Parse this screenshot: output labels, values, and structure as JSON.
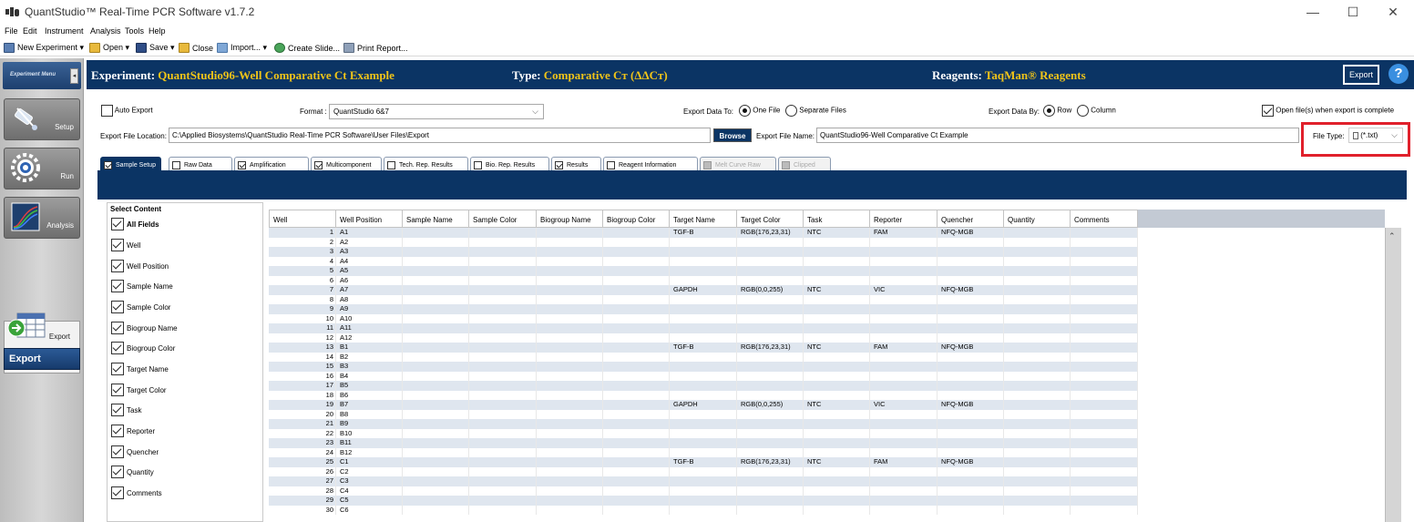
{
  "window": {
    "title": "QuantStudio™ Real-Time PCR Software v1.7.2",
    "minimize": "—",
    "maximize": "☐",
    "close": "✕"
  },
  "menu": [
    "File",
    "Edit",
    "Instrument",
    "Analysis",
    "Tools",
    "Help"
  ],
  "toolbar": {
    "new_experiment": "New Experiment ▾",
    "open": "Open ▾",
    "save": "Save ▾",
    "close": "Close",
    "import": "Import... ▾",
    "create_slide": "Create Slide...",
    "print_report": "Print Report..."
  },
  "nav": {
    "home": "Experiment Menu",
    "collapse": "◂",
    "setup": "Setup",
    "run": "Run",
    "analysis": "Analysis",
    "export": "Export",
    "export_sub": "Export"
  },
  "header": {
    "experiment_label": "Experiment:",
    "experiment_value": "QuantStudio96-Well Comparative Ct Example",
    "type_label": "Type:",
    "type_value": "Comparative Cт (ΔΔCт)",
    "reagents_label": "Reagents:",
    "reagents_value": "TaqMan® Reagents",
    "export_button": "Export",
    "help": "?"
  },
  "options": {
    "auto_export": "Auto Export",
    "format_label": "Format :",
    "format_value": "QuantStudio 6&7",
    "export_to_label": "Export Data To:",
    "one_file": "One File",
    "separate_files": "Separate Files",
    "export_by_label": "Export Data By:",
    "row": "Row",
    "column": "Column",
    "open_when_complete": "Open file(s) when export is complete",
    "location_label": "Export File Location:",
    "location_value": "C:\\Applied Biosystems\\QuantStudio Real-Time PCR Software\\User Files\\Export",
    "browse": "Browse",
    "file_name_label": "Export File Name:",
    "file_name_value": "QuantStudio96-Well Comparative Ct Example",
    "file_type_label": "File Type:",
    "file_type_value": "(*.txt)"
  },
  "tabs": [
    {
      "label": "Sample Setup",
      "state": "active"
    },
    {
      "label": "Raw Data",
      "state": "off"
    },
    {
      "label": "Amplification",
      "state": "on"
    },
    {
      "label": "Multicomponent",
      "state": "on"
    },
    {
      "label": "Tech. Rep. Results",
      "state": "off"
    },
    {
      "label": "Bio. Rep. Results",
      "state": "off"
    },
    {
      "label": "Results",
      "state": "on"
    },
    {
      "label": "Reagent Information",
      "state": "off"
    },
    {
      "label": "Melt Curve Raw",
      "state": "disabled"
    },
    {
      "label": "Clipped",
      "state": "disabled"
    }
  ],
  "select_content": {
    "title": "Select Content",
    "items": [
      "All Fields",
      "Well",
      "Well Position",
      "Sample Name",
      "Sample Color",
      "Biogroup Name",
      "Biogroup Color",
      "Target Name",
      "Target Color",
      "Task",
      "Reporter",
      "Quencher",
      "Quantity",
      "Comments"
    ]
  },
  "grid": {
    "columns": [
      "Well",
      "Well Position",
      "Sample Name",
      "Sample Color",
      "Biogroup Name",
      "Biogroup Color",
      "Target Name",
      "Target Color",
      "Task",
      "Reporter",
      "Quencher",
      "Quantity",
      "Comments"
    ],
    "rows": [
      [
        "1",
        "A1",
        "",
        "",
        "",
        "",
        "TGF-B",
        "RGB(176,23,31)",
        "NTC",
        "FAM",
        "NFQ-MGB",
        "",
        ""
      ],
      [
        "2",
        "A2",
        "",
        "",
        "",
        "",
        "",
        "",
        "",
        "",
        "",
        "",
        ""
      ],
      [
        "3",
        "A3",
        "",
        "",
        "",
        "",
        "",
        "",
        "",
        "",
        "",
        "",
        ""
      ],
      [
        "4",
        "A4",
        "",
        "",
        "",
        "",
        "",
        "",
        "",
        "",
        "",
        "",
        ""
      ],
      [
        "5",
        "A5",
        "",
        "",
        "",
        "",
        "",
        "",
        "",
        "",
        "",
        "",
        ""
      ],
      [
        "6",
        "A6",
        "",
        "",
        "",
        "",
        "",
        "",
        "",
        "",
        "",
        "",
        ""
      ],
      [
        "7",
        "A7",
        "",
        "",
        "",
        "",
        "GAPDH",
        "RGB(0,0,255)",
        "NTC",
        "VIC",
        "NFQ-MGB",
        "",
        ""
      ],
      [
        "8",
        "A8",
        "",
        "",
        "",
        "",
        "",
        "",
        "",
        "",
        "",
        "",
        ""
      ],
      [
        "9",
        "A9",
        "",
        "",
        "",
        "",
        "",
        "",
        "",
        "",
        "",
        "",
        ""
      ],
      [
        "10",
        "A10",
        "",
        "",
        "",
        "",
        "",
        "",
        "",
        "",
        "",
        "",
        ""
      ],
      [
        "11",
        "A11",
        "",
        "",
        "",
        "",
        "",
        "",
        "",
        "",
        "",
        "",
        ""
      ],
      [
        "12",
        "A12",
        "",
        "",
        "",
        "",
        "",
        "",
        "",
        "",
        "",
        "",
        ""
      ],
      [
        "13",
        "B1",
        "",
        "",
        "",
        "",
        "TGF-B",
        "RGB(176,23,31)",
        "NTC",
        "FAM",
        "NFQ-MGB",
        "",
        ""
      ],
      [
        "14",
        "B2",
        "",
        "",
        "",
        "",
        "",
        "",
        "",
        "",
        "",
        "",
        ""
      ],
      [
        "15",
        "B3",
        "",
        "",
        "",
        "",
        "",
        "",
        "",
        "",
        "",
        "",
        ""
      ],
      [
        "16",
        "B4",
        "",
        "",
        "",
        "",
        "",
        "",
        "",
        "",
        "",
        "",
        ""
      ],
      [
        "17",
        "B5",
        "",
        "",
        "",
        "",
        "",
        "",
        "",
        "",
        "",
        "",
        ""
      ],
      [
        "18",
        "B6",
        "",
        "",
        "",
        "",
        "",
        "",
        "",
        "",
        "",
        "",
        ""
      ],
      [
        "19",
        "B7",
        "",
        "",
        "",
        "",
        "GAPDH",
        "RGB(0,0,255)",
        "NTC",
        "VIC",
        "NFQ-MGB",
        "",
        ""
      ],
      [
        "20",
        "B8",
        "",
        "",
        "",
        "",
        "",
        "",
        "",
        "",
        "",
        "",
        ""
      ],
      [
        "21",
        "B9",
        "",
        "",
        "",
        "",
        "",
        "",
        "",
        "",
        "",
        "",
        ""
      ],
      [
        "22",
        "B10",
        "",
        "",
        "",
        "",
        "",
        "",
        "",
        "",
        "",
        "",
        ""
      ],
      [
        "23",
        "B11",
        "",
        "",
        "",
        "",
        "",
        "",
        "",
        "",
        "",
        "",
        ""
      ],
      [
        "24",
        "B12",
        "",
        "",
        "",
        "",
        "",
        "",
        "",
        "",
        "",
        "",
        ""
      ],
      [
        "25",
        "C1",
        "",
        "",
        "",
        "",
        "TGF-B",
        "RGB(176,23,31)",
        "NTC",
        "FAM",
        "NFQ-MGB",
        "",
        ""
      ],
      [
        "26",
        "C2",
        "",
        "",
        "",
        "",
        "",
        "",
        "",
        "",
        "",
        "",
        ""
      ],
      [
        "27",
        "C3",
        "",
        "",
        "",
        "",
        "",
        "",
        "",
        "",
        "",
        "",
        ""
      ],
      [
        "28",
        "C4",
        "",
        "",
        "",
        "",
        "",
        "",
        "",
        "",
        "",
        "",
        ""
      ],
      [
        "29",
        "C5",
        "",
        "",
        "",
        "",
        "",
        "",
        "",
        "",
        "",
        "",
        ""
      ],
      [
        "30",
        "C6",
        "",
        "",
        "",
        "",
        "",
        "",
        "",
        "",
        "",
        "",
        ""
      ]
    ]
  },
  "colors": {
    "header_bg": "#0b3464",
    "header_accent": "#f0c419",
    "alt_row": "#dfe6ef",
    "highlight_box": "#e0202b"
  }
}
